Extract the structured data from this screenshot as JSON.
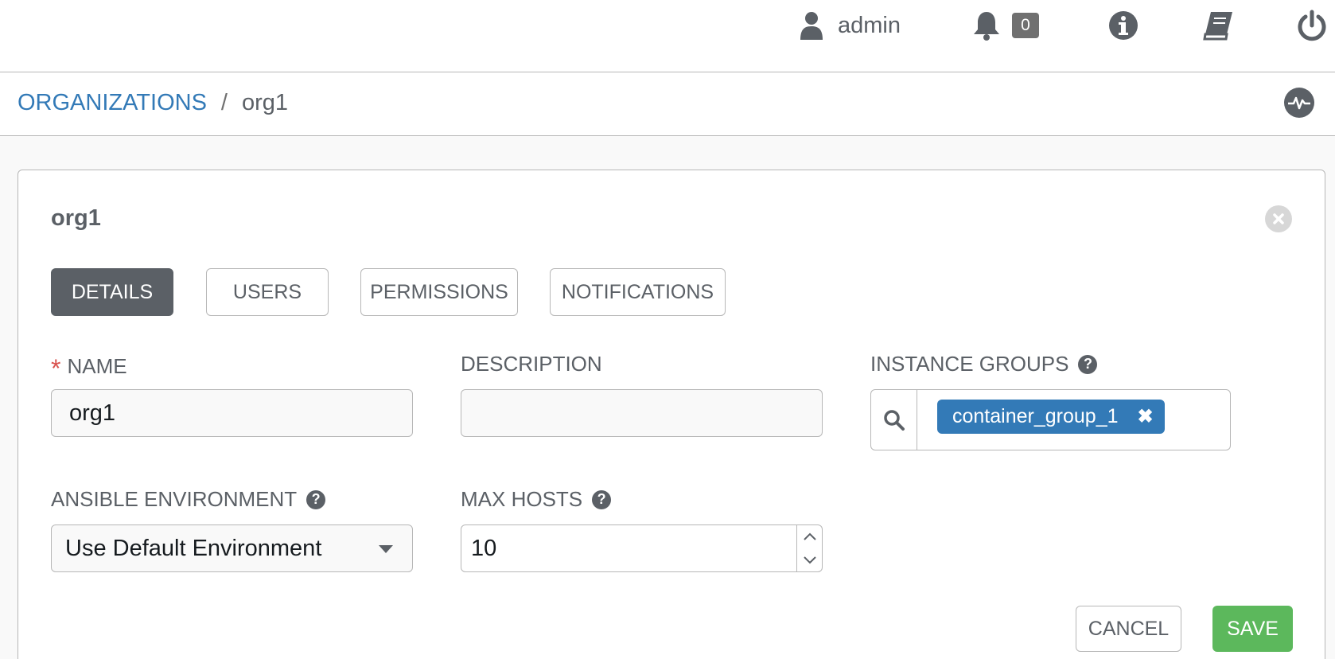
{
  "topbar": {
    "user": "admin",
    "notification_count": "0"
  },
  "breadcrumb": {
    "parent": "ORGANIZATIONS",
    "separator": "/",
    "current": "org1"
  },
  "panel": {
    "title": "org1",
    "tabs": [
      {
        "label": "DETAILS",
        "active": true
      },
      {
        "label": "USERS",
        "active": false
      },
      {
        "label": "PERMISSIONS",
        "active": false
      },
      {
        "label": "NOTIFICATIONS",
        "active": false
      }
    ],
    "fields": {
      "name": {
        "label": "NAME",
        "required_mark": "*",
        "value": "org1"
      },
      "description": {
        "label": "DESCRIPTION",
        "value": ""
      },
      "instance_groups": {
        "label": "INSTANCE GROUPS",
        "help": "?",
        "tags": [
          "container_group_1"
        ],
        "tag_remove": "✖"
      },
      "ansible_environment": {
        "label": "ANSIBLE ENVIRONMENT",
        "help": "?",
        "value": "Use Default Environment"
      },
      "max_hosts": {
        "label": "MAX HOSTS",
        "help": "?",
        "value": "10"
      }
    },
    "buttons": {
      "cancel": "CANCEL",
      "save": "SAVE"
    }
  },
  "colors": {
    "link": "#337ab7",
    "active_tab": "#5b6066",
    "save": "#5cb85c",
    "required": "#d9534f"
  }
}
